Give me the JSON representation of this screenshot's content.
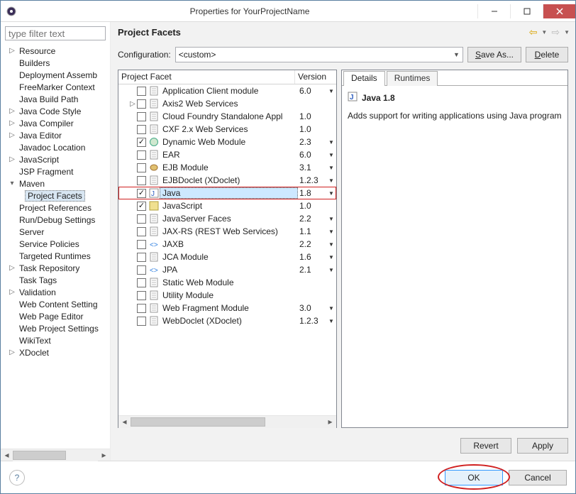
{
  "window": {
    "title": "Properties for YourProjectName"
  },
  "sidebar": {
    "filter_placeholder": "type filter text",
    "groups": [
      {
        "expandable": true,
        "label": "Resource",
        "children": []
      },
      {
        "expandable": false,
        "label": "Builders"
      },
      {
        "expandable": false,
        "label": "Deployment Assemb"
      },
      {
        "expandable": false,
        "label": "FreeMarker Context"
      },
      {
        "expandable": false,
        "label": "Java Build Path"
      },
      {
        "expandable": true,
        "label": "Java Code Style"
      },
      {
        "expandable": true,
        "label": "Java Compiler"
      },
      {
        "expandable": true,
        "label": "Java Editor"
      },
      {
        "expandable": false,
        "label": "Javadoc Location"
      },
      {
        "expandable": true,
        "label": "JavaScript"
      },
      {
        "expandable": false,
        "label": "JSP Fragment"
      },
      {
        "expandable": true,
        "label": "Maven",
        "expanded": true,
        "children": [
          {
            "label": "Project Facets",
            "selected": true
          }
        ]
      },
      {
        "expandable": false,
        "label": "Project References"
      },
      {
        "expandable": false,
        "label": "Run/Debug Settings"
      },
      {
        "expandable": false,
        "label": "Server"
      },
      {
        "expandable": false,
        "label": "Service Policies"
      },
      {
        "expandable": false,
        "label": "Targeted Runtimes"
      },
      {
        "expandable": true,
        "label": "Task Repository"
      },
      {
        "expandable": false,
        "label": "Task Tags"
      },
      {
        "expandable": true,
        "label": "Validation"
      },
      {
        "expandable": false,
        "label": "Web Content Setting"
      },
      {
        "expandable": false,
        "label": "Web Page Editor"
      },
      {
        "expandable": false,
        "label": "Web Project Settings"
      },
      {
        "expandable": false,
        "label": "WikiText"
      },
      {
        "expandable": true,
        "label": "XDoclet"
      }
    ]
  },
  "page": {
    "title": "Project Facets",
    "config_label": "Configuration:",
    "config_value": "<custom>",
    "save_as": "Save As...",
    "delete": "Delete",
    "col_facet": "Project Facet",
    "col_version": "Version",
    "facets": [
      {
        "tw": "",
        "checked": false,
        "icon": "page",
        "name": "Application Client module",
        "ver": "6.0",
        "dd": true
      },
      {
        "tw": "▷",
        "checked": false,
        "icon": "page",
        "name": "Axis2 Web Services",
        "ver": "",
        "dd": false
      },
      {
        "tw": "",
        "checked": false,
        "icon": "page",
        "name": "Cloud Foundry Standalone Appl",
        "ver": "1.0",
        "dd": false
      },
      {
        "tw": "",
        "checked": false,
        "icon": "page",
        "name": "CXF 2.x Web Services",
        "ver": "1.0",
        "dd": false
      },
      {
        "tw": "",
        "checked": true,
        "icon": "globe",
        "name": "Dynamic Web Module",
        "ver": "2.3",
        "dd": true
      },
      {
        "tw": "",
        "checked": false,
        "icon": "page",
        "name": "EAR",
        "ver": "6.0",
        "dd": true
      },
      {
        "tw": "",
        "checked": false,
        "icon": "bean",
        "name": "EJB Module",
        "ver": "3.1",
        "dd": true
      },
      {
        "tw": "",
        "checked": false,
        "icon": "page",
        "name": "EJBDoclet (XDoclet)",
        "ver": "1.2.3",
        "dd": true
      },
      {
        "tw": "",
        "checked": true,
        "icon": "java",
        "name": "Java",
        "ver": "1.8",
        "dd": true,
        "highlight": true,
        "sel": true
      },
      {
        "tw": "",
        "checked": true,
        "icon": "js",
        "name": "JavaScript",
        "ver": "1.0",
        "dd": false
      },
      {
        "tw": "",
        "checked": false,
        "icon": "page",
        "name": "JavaServer Faces",
        "ver": "2.2",
        "dd": true
      },
      {
        "tw": "",
        "checked": false,
        "icon": "page",
        "name": "JAX-RS (REST Web Services)",
        "ver": "1.1",
        "dd": true
      },
      {
        "tw": "",
        "checked": false,
        "icon": "xml",
        "name": "JAXB",
        "ver": "2.2",
        "dd": true
      },
      {
        "tw": "",
        "checked": false,
        "icon": "page",
        "name": "JCA Module",
        "ver": "1.6",
        "dd": true
      },
      {
        "tw": "",
        "checked": false,
        "icon": "xml",
        "name": "JPA",
        "ver": "2.1",
        "dd": true
      },
      {
        "tw": "",
        "checked": false,
        "icon": "page",
        "name": "Static Web Module",
        "ver": "",
        "dd": false
      },
      {
        "tw": "",
        "checked": false,
        "icon": "page",
        "name": "Utility Module",
        "ver": "",
        "dd": false
      },
      {
        "tw": "",
        "checked": false,
        "icon": "page",
        "name": "Web Fragment Module",
        "ver": "3.0",
        "dd": true
      },
      {
        "tw": "",
        "checked": false,
        "icon": "page",
        "name": "WebDoclet (XDoclet)",
        "ver": "1.2.3",
        "dd": true
      }
    ],
    "tabs": {
      "details": "Details",
      "runtimes": "Runtimes"
    },
    "detail_title": "Java 1.8",
    "detail_desc": "Adds support for writing applications using Java programm",
    "revert": "Revert",
    "apply": "Apply"
  },
  "footer": {
    "ok": "OK",
    "cancel": "Cancel"
  }
}
